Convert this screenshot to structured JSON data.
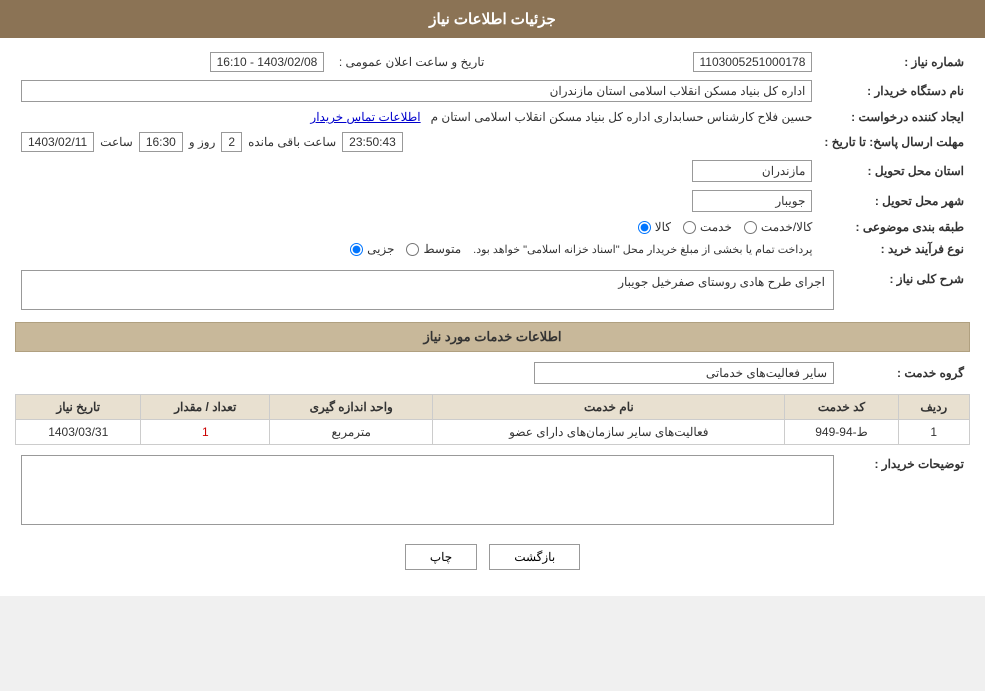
{
  "header": {
    "title": "جزئیات اطلاعات نیاز"
  },
  "fields": {
    "shomara_niaz_label": "شماره نیاز :",
    "shomara_niaz_value": "1103005251000178",
    "nam_dastgah_label": "نام دستگاه خریدار :",
    "nam_dastgah_value": "اداره کل بنیاد مسکن انقلاب اسلامی استان مازندران",
    "ijad_konande_label": "ایجاد کننده درخواست :",
    "ijad_konande_value": "حسین فلاح کارشناس حسابداری اداره کل بنیاد مسکن انقلاب اسلامی استان م",
    "ijad_konande_link": "اطلاعات تماس خریدار",
    "mohlat_label": "مهلت ارسال پاسخ: تا تاریخ :",
    "date_value": "1403/02/11",
    "saat_label": "ساعت",
    "saat_value": "16:30",
    "rooz_label": "روز و",
    "rooz_value": "2",
    "baqi_mande_label": "ساعت باقی مانده",
    "baqi_mande_value": "23:50:43",
    "ostan_label": "استان محل تحویل :",
    "ostan_value": "مازندران",
    "shahr_label": "شهر محل تحویل :",
    "shahr_value": "جویبار",
    "tasnif_label": "طبقه بندی موضوعی :",
    "tasnif_kala": "کالا",
    "tasnif_khedmat": "خدمت",
    "tasnif_kala_khedmat": "کالا/خدمت",
    "nooe_farayand_label": "نوع فرآیند خرید :",
    "nooe_jozyi": "جزیی",
    "nooe_motawaset": "متوسط",
    "nooe_note": "پرداخت تمام یا بخشی از مبلغ خریدار محل \"اسناد خزانه اسلامی\" خواهد بود.",
    "tarikh_saaat_label": "تاریخ و ساعت اعلان عمومی :",
    "tarikh_saat_value": "1403/02/08 - 16:10",
    "sharh_label": "شرح کلی نیاز :",
    "sharh_value": "اجرای طرح هادی روستای صفرخیل جویبار",
    "service_info_header": "اطلاعات خدمات مورد نیاز",
    "grooh_khedmat_label": "گروه خدمت :",
    "grooh_khedmat_value": "سایر فعالیت‌های خدماتی",
    "table": {
      "cols": [
        "ردیف",
        "کد خدمت",
        "نام خدمت",
        "واحد اندازه گیری",
        "تعداد / مقدار",
        "تاریخ نیاز"
      ],
      "rows": [
        {
          "radif": "1",
          "code": "ط-94-949",
          "name": "فعالیت‌های سایر سازمان‌های دارای عضو",
          "unit": "مترمربع",
          "count": "1",
          "date": "1403/03/31"
        }
      ]
    },
    "tawzih_label": "توضیحات خریدار :",
    "tawzih_value": ""
  },
  "buttons": {
    "print": "چاپ",
    "back": "بازگشت"
  },
  "colors": {
    "header_bg": "#8B7355",
    "section_header_bg": "#c8b89a",
    "link_color": "#0000cc",
    "red": "#cc0000"
  }
}
